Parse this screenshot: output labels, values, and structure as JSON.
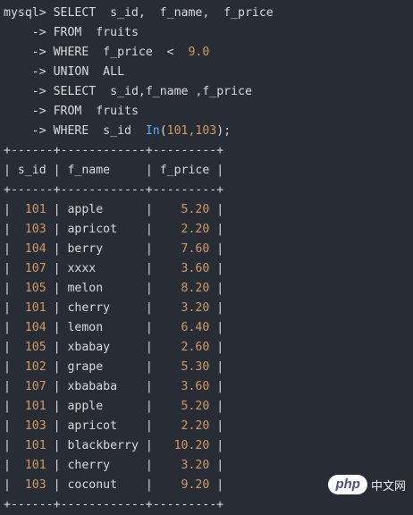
{
  "query": {
    "prompt": "mysql>",
    "continuation": "->",
    "lines": [
      "SELECT  s_id,  f_name,  f_price",
      "FROM  fruits",
      "WHERE  f_price  <  ",
      "UNION  ALL",
      "SELECT  s_id,f_name ,f_price",
      "FROM  fruits",
      "WHERE  s_id  "
    ],
    "where_value": "9.0",
    "in_func": "In",
    "in_args_open": "(",
    "in_args": "101,103",
    "in_args_close": ");"
  },
  "result": {
    "border": "+------+------------+---------+",
    "columns": [
      "s_id",
      "f_name",
      "f_price"
    ],
    "rows": [
      {
        "s_id": "101",
        "f_name": "apple",
        "f_price": "5.20"
      },
      {
        "s_id": "103",
        "f_name": "apricot",
        "f_price": "2.20"
      },
      {
        "s_id": "104",
        "f_name": "berry",
        "f_price": "7.60"
      },
      {
        "s_id": "107",
        "f_name": "xxxx",
        "f_price": "3.60"
      },
      {
        "s_id": "105",
        "f_name": "melon",
        "f_price": "8.20"
      },
      {
        "s_id": "101",
        "f_name": "cherry",
        "f_price": "3.20"
      },
      {
        "s_id": "104",
        "f_name": "lemon",
        "f_price": "6.40"
      },
      {
        "s_id": "105",
        "f_name": "xbabay",
        "f_price": "2.60"
      },
      {
        "s_id": "102",
        "f_name": "grape",
        "f_price": "5.30"
      },
      {
        "s_id": "107",
        "f_name": "xbababa",
        "f_price": "3.60"
      },
      {
        "s_id": "101",
        "f_name": "apple",
        "f_price": "5.20"
      },
      {
        "s_id": "103",
        "f_name": "apricot",
        "f_price": "2.20"
      },
      {
        "s_id": "101",
        "f_name": "blackberry",
        "f_price": "10.20"
      },
      {
        "s_id": "101",
        "f_name": "cherry",
        "f_price": "3.20"
      },
      {
        "s_id": "103",
        "f_name": "coconut",
        "f_price": "9.20"
      }
    ]
  },
  "watermark": {
    "logo": "php",
    "text": "中文网"
  }
}
